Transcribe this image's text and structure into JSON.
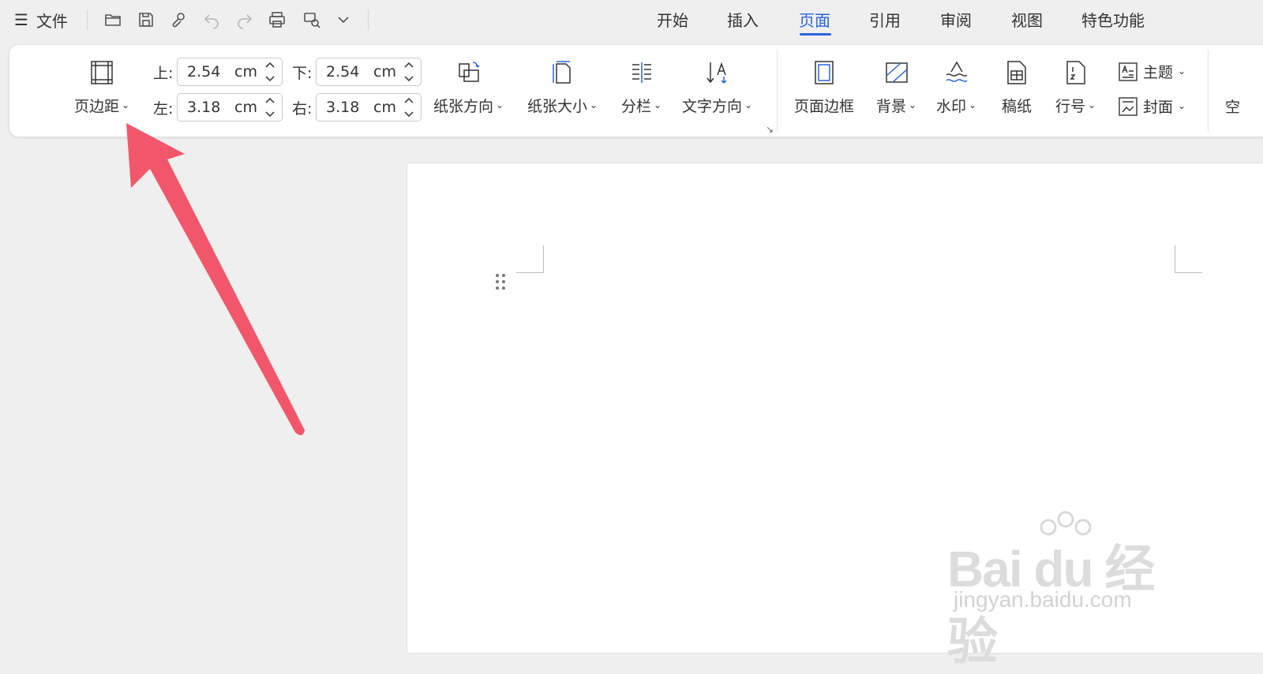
{
  "topbar": {
    "menu_label": "文件",
    "tabs": [
      {
        "label": "开始"
      },
      {
        "label": "插入"
      },
      {
        "label": "页面",
        "active": true
      },
      {
        "label": "引用"
      },
      {
        "label": "审阅"
      },
      {
        "label": "视图"
      },
      {
        "label": "特色功能"
      }
    ],
    "active_color": "#2a64d9"
  },
  "ribbon": {
    "margins_button": "页边距",
    "margins": {
      "top": {
        "label": "上:",
        "value": "2.54",
        "unit": "cm"
      },
      "bottom": {
        "label": "下:",
        "value": "2.54",
        "unit": "cm"
      },
      "left": {
        "label": "左:",
        "value": "3.18",
        "unit": "cm"
      },
      "right": {
        "label": "右:",
        "value": "3.18",
        "unit": "cm"
      }
    },
    "buttons": {
      "orientation": "纸张方向",
      "size": "纸张大小",
      "columns": "分栏",
      "text_direction": "文字方向",
      "page_border": "页面边框",
      "background": "背景",
      "watermark": "水印",
      "manuscript": "稿纸",
      "line_number": "行号",
      "theme": "主题",
      "cover": "封面",
      "partial": "空"
    }
  },
  "annotation": {
    "arrow_color": "#f2566a"
  },
  "watermark": {
    "main": "Bai du 经验",
    "sub": "jingyan.baidu.com"
  }
}
